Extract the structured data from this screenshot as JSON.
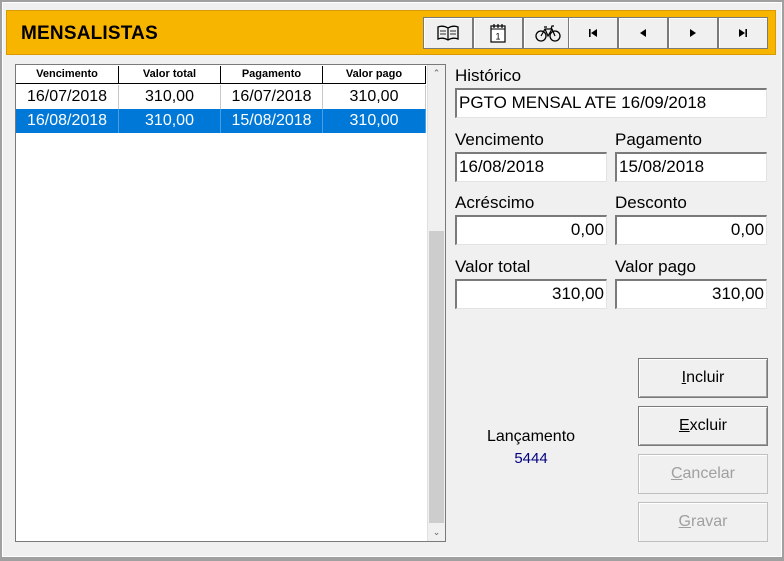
{
  "header": {
    "title": "MENSALISTAS",
    "toolbar": [
      {
        "icon": "book-icon"
      },
      {
        "icon": "calendar-icon",
        "text": "1"
      },
      {
        "icon": "bicycle-icon"
      },
      {
        "icon": "first-record-icon"
      },
      {
        "icon": "previous-record-icon"
      },
      {
        "icon": "next-record-icon"
      },
      {
        "icon": "last-record-icon"
      }
    ]
  },
  "grid": {
    "columns": [
      "Vencimento",
      "Valor total",
      "Pagamento",
      "Valor pago"
    ],
    "rows": [
      {
        "vencimento": "16/07/2018",
        "valor_total": "310,00",
        "pagamento": "16/07/2018",
        "valor_pago": "310,00",
        "selected": false
      },
      {
        "vencimento": "16/08/2018",
        "valor_total": "310,00",
        "pagamento": "15/08/2018",
        "valor_pago": "310,00",
        "selected": true
      }
    ]
  },
  "form": {
    "historico_label": "Histórico",
    "historico_value": "PGTO MENSAL ATE 16/09/2018",
    "vencimento_label": "Vencimento",
    "vencimento_value": "16/08/2018",
    "pagamento_label": "Pagamento",
    "pagamento_value": "15/08/2018",
    "acrescimo_label": "Acréscimo",
    "acrescimo_value": "0,00",
    "desconto_label": "Desconto",
    "desconto_value": "0,00",
    "valor_total_label": "Valor total",
    "valor_total_value": "310,00",
    "valor_pago_label": "Valor pago",
    "valor_pago_value": "310,00"
  },
  "lancamento": {
    "label": "Lançamento",
    "value": "5444"
  },
  "buttons": {
    "incluir": {
      "accel": "I",
      "rest": "ncluir",
      "enabled": true
    },
    "excluir": {
      "accel": "E",
      "rest": "xcluir",
      "enabled": true
    },
    "cancelar": {
      "accel": "C",
      "rest": "ancelar",
      "enabled": false
    },
    "gravar": {
      "accel": "G",
      "rest": "ravar",
      "enabled": false
    }
  },
  "colors": {
    "header_bg": "#f7b500",
    "selection_bg": "#0078d7",
    "lancamento_value": "#000080"
  }
}
